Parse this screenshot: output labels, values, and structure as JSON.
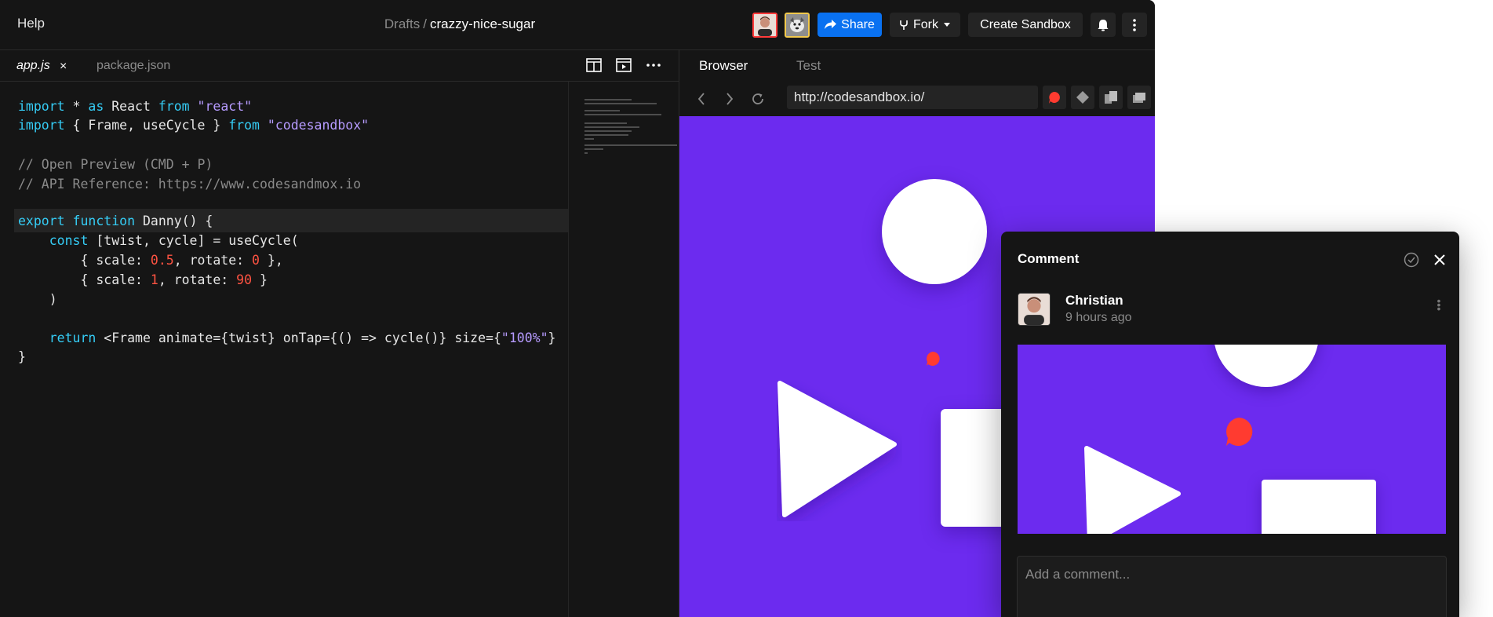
{
  "topbar": {
    "help": "Help",
    "breadcrumb_folder": "Drafts",
    "breadcrumb_sep": "/",
    "sandbox_name": "crazzy-nice-sugar",
    "share_label": "Share",
    "fork_label": "Fork",
    "create_label": "Create Sandbox"
  },
  "editor": {
    "tabs": [
      {
        "label": "app.js",
        "active": true
      },
      {
        "label": "package.json",
        "active": false
      }
    ],
    "close_glyph": "×"
  },
  "browser": {
    "tabs": [
      "Browser",
      "Test"
    ],
    "url": "http://codesandbox.io/"
  },
  "comment": {
    "title": "Comment",
    "author": "Christian",
    "time": "9 hours ago",
    "placeholder": "Add a comment..."
  },
  "colors": {
    "accent": "#0971f1",
    "preview_bg": "#6c2bef",
    "marker": "#ff3b30",
    "keyword": "#35cdf6",
    "string": "#b69bff",
    "number": "#ff5342"
  }
}
